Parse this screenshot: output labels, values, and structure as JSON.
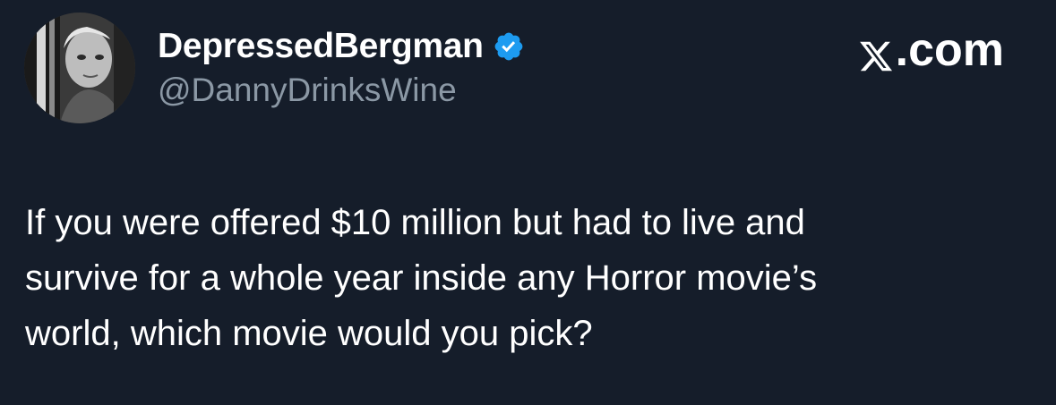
{
  "author": {
    "display_name": "DepressedBergman",
    "handle": "@DannyDrinksWine",
    "verified": true,
    "verified_color": "#1d9bf0"
  },
  "brand": {
    "suffix": ".com",
    "icon": "x-logo-icon"
  },
  "tweet": {
    "lines": [
      "If you were offered $10 million but had to live and",
      "survive for a whole year inside any Horror movie’s",
      "world, which movie would you pick?"
    ]
  },
  "colors": {
    "background": "#151d2a",
    "text": "#ffffff",
    "secondary_text": "#8b98a5"
  }
}
